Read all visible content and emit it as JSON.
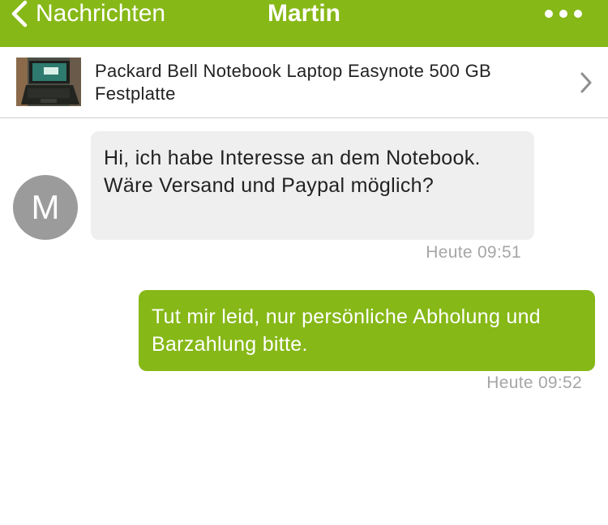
{
  "navbar": {
    "back_label": "Nachrichten",
    "title": "Martin",
    "more_icon": "more-dots-icon",
    "color": "#86b817"
  },
  "product": {
    "title": "Packard Bell Notebook Laptop Easynote 500 GB Festplatte",
    "chevron_icon": "chevron-right-icon"
  },
  "messages": [
    {
      "direction": "incoming",
      "avatar_letter": "M",
      "text": "Hi, ich habe Interesse an dem Notebook. Wäre Versand und Paypal möglich?",
      "time": "Heute 09:51"
    },
    {
      "direction": "outgoing",
      "text": "Tut mir leid, nur persönliche Abholung und Barzahlung bitte.",
      "time": "Heute 09:52"
    }
  ],
  "colors": {
    "accent": "#86b817",
    "incoming_bubble": "#efefef",
    "avatar": "#9b9b9b",
    "timestamp": "#a6a6a6"
  }
}
